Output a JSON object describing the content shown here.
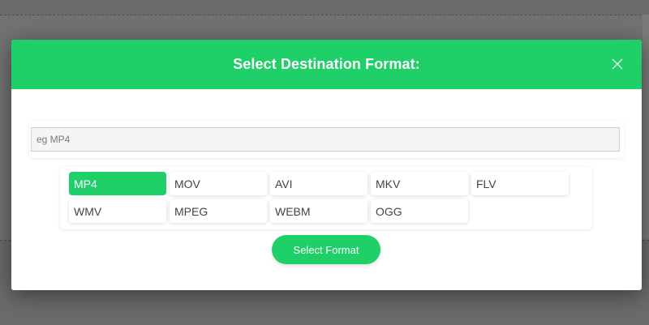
{
  "modal": {
    "title": "Select Destination Format:",
    "close_icon": "close-icon",
    "header_color": "#1fcf67"
  },
  "search": {
    "placeholder": "eg MP4",
    "value": ""
  },
  "formats": [
    {
      "label": "MP4",
      "selected": true
    },
    {
      "label": "MOV",
      "selected": false
    },
    {
      "label": "AVI",
      "selected": false
    },
    {
      "label": "MKV",
      "selected": false
    },
    {
      "label": "FLV",
      "selected": false
    },
    {
      "label": "WMV",
      "selected": false
    },
    {
      "label": "MPEG",
      "selected": false
    },
    {
      "label": "WEBM",
      "selected": false
    },
    {
      "label": "OGG",
      "selected": false
    }
  ],
  "actions": {
    "select_label": "Select Format"
  }
}
